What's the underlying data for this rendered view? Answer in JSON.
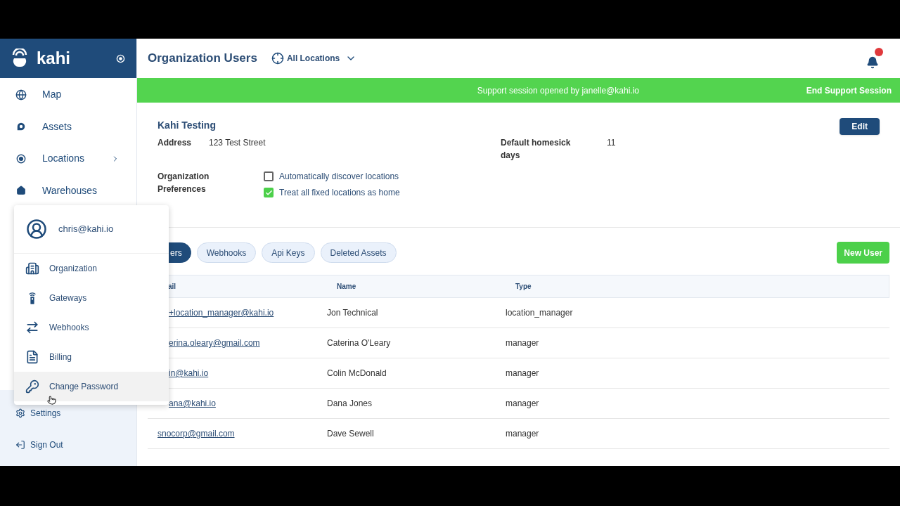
{
  "sidebar": {
    "brand": "kahi",
    "items": [
      {
        "label": "Map",
        "has_submenu": false
      },
      {
        "label": "Assets",
        "has_submenu": false
      },
      {
        "label": "Locations",
        "has_submenu": true
      },
      {
        "label": "Warehouses",
        "has_submenu": false
      }
    ],
    "bottom_items": [
      {
        "label": "Settings"
      },
      {
        "label": "Sign Out"
      }
    ]
  },
  "user_menu": {
    "user": "chris@kahi.io",
    "items": [
      {
        "label": "Organization",
        "highlighted": false
      },
      {
        "label": "Gateways",
        "highlighted": false
      },
      {
        "label": "Webhooks",
        "highlighted": false
      },
      {
        "label": "Billing",
        "highlighted": false
      },
      {
        "label": "Change Password",
        "highlighted": true
      }
    ]
  },
  "header": {
    "title": "Organization Users",
    "location_filter": "All Locations"
  },
  "banner": {
    "message": "Support session opened by janelle@kahi.io",
    "action": "End Support Session"
  },
  "organization": {
    "name": "Kahi Testing",
    "edit": "Edit",
    "address_label": "Address",
    "address": "123 Test Street",
    "homesick_label": "Default homesick days",
    "homesick": "11",
    "preferences_label": "Organization Preferences",
    "preferences": [
      {
        "label": "Automatically discover locations",
        "checked": false
      },
      {
        "label": "Treat all fixed locations as home",
        "checked": true
      }
    ]
  },
  "tabs": [
    {
      "label": "ers",
      "selected": true,
      "cut": true
    },
    {
      "label": "Webhooks",
      "selected": false,
      "cut": false
    },
    {
      "label": "Api Keys",
      "selected": false,
      "cut": false
    },
    {
      "label": "Deleted Assets",
      "selected": false,
      "cut": false
    }
  ],
  "new_user": "New User",
  "table": {
    "columns": [
      {
        "label": "ail",
        "cut": true
      },
      {
        "label": "Name",
        "cut": false
      },
      {
        "label": "Type",
        "cut": false
      }
    ],
    "rows": [
      {
        "email": "+location_manager@kahi.io",
        "cut": true,
        "name": "Jon Technical",
        "type": "location_manager"
      },
      {
        "email": "erina.oleary@gmail.com",
        "cut": true,
        "name": "Caterina O'Leary",
        "type": "manager"
      },
      {
        "email": "in@kahi.io",
        "cut": true,
        "name": "Colin McDonald",
        "type": "manager"
      },
      {
        "email": "ana@kahi.io",
        "cut": true,
        "name": "Dana Jones",
        "type": "manager"
      },
      {
        "email": "snocorp@gmail.com",
        "cut": false,
        "name": "Dave Sewell",
        "type": "manager"
      }
    ]
  }
}
